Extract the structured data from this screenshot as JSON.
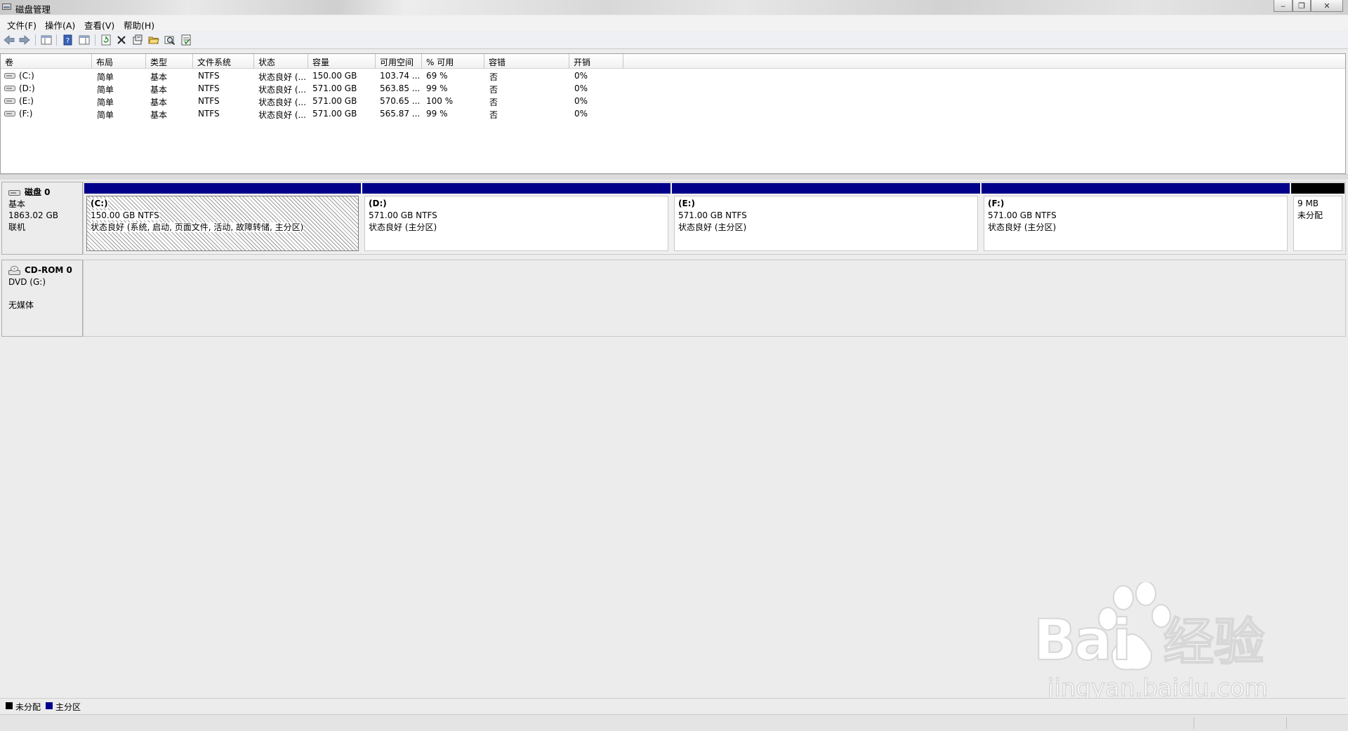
{
  "window": {
    "title": "磁盘管理",
    "app_icon": "disk-management-icon"
  },
  "window_buttons": {
    "minimize": "minimize-icon",
    "restore": "restore-icon",
    "close": "close-icon"
  },
  "menu": [
    "文件(F)",
    "操作(A)",
    "查看(V)",
    "帮助(H)"
  ],
  "toolbar": [
    "back-arrow-icon",
    "forward-arrow-icon",
    "show-hide-console-tree-icon",
    "help-icon",
    "properties-pane-icon",
    "refresh-icon",
    "delete-icon",
    "properties-icon",
    "open-icon",
    "explore-icon",
    "rescan-icon"
  ],
  "volume_list": {
    "columns": [
      "卷",
      "布局",
      "类型",
      "文件系统",
      "状态",
      "容量",
      "可用空间",
      "% 可用",
      "容错",
      "开销"
    ],
    "rows": [
      [
        "(C:)",
        "简单",
        "基本",
        "NTFS",
        "状态良好 (...",
        "150.00 GB",
        "103.74 ...",
        "69 %",
        "否",
        "0%"
      ],
      [
        "(D:)",
        "简单",
        "基本",
        "NTFS",
        "状态良好 (...",
        "571.00 GB",
        "563.85 ...",
        "99 %",
        "否",
        "0%"
      ],
      [
        "(E:)",
        "简单",
        "基本",
        "NTFS",
        "状态良好 (...",
        "571.00 GB",
        "570.65 ...",
        "100 %",
        "否",
        "0%"
      ],
      [
        "(F:)",
        "简单",
        "基本",
        "NTFS",
        "状态良好 (...",
        "571.00 GB",
        "565.87 ...",
        "99 %",
        "否",
        "0%"
      ]
    ]
  },
  "disks": [
    {
      "name": "磁盘 0",
      "type": "基本",
      "size": "1863.02 GB",
      "status": "联机",
      "icon": "hard-disk-icon",
      "partitions": [
        {
          "name": "(C:)",
          "size_fs": "150.00 GB NTFS",
          "status": "状态良好 (系统, 启动, 页面文件, 活动, 故障转储, 主分区)",
          "kind": "primary",
          "selected": true
        },
        {
          "name": "(D:)",
          "size_fs": "571.00 GB NTFS",
          "status": "状态良好 (主分区)",
          "kind": "primary",
          "selected": false
        },
        {
          "name": "(E:)",
          "size_fs": "571.00 GB NTFS",
          "status": "状态良好 (主分区)",
          "kind": "primary",
          "selected": false
        },
        {
          "name": "(F:)",
          "size_fs": "571.00 GB NTFS",
          "status": "状态良好 (主分区)",
          "kind": "primary",
          "selected": false
        },
        {
          "name": "",
          "size_fs": "9 MB",
          "status": "未分配",
          "kind": "unallocated",
          "selected": false
        }
      ]
    },
    {
      "name": "CD-ROM 0",
      "type": "DVD (G:)",
      "size": "",
      "status": "无媒体",
      "icon": "cd-rom-icon"
    }
  ],
  "legend": [
    {
      "label": "未分配",
      "color": "#000000"
    },
    {
      "label": "主分区",
      "color": "#00008b"
    }
  ],
  "colors": {
    "primary": "#00008b",
    "unallocated": "#000000"
  },
  "watermark": {
    "brand": "Bai",
    "brand2": "du",
    "cn": "经验",
    "url": "jingyan.baidu.com"
  }
}
